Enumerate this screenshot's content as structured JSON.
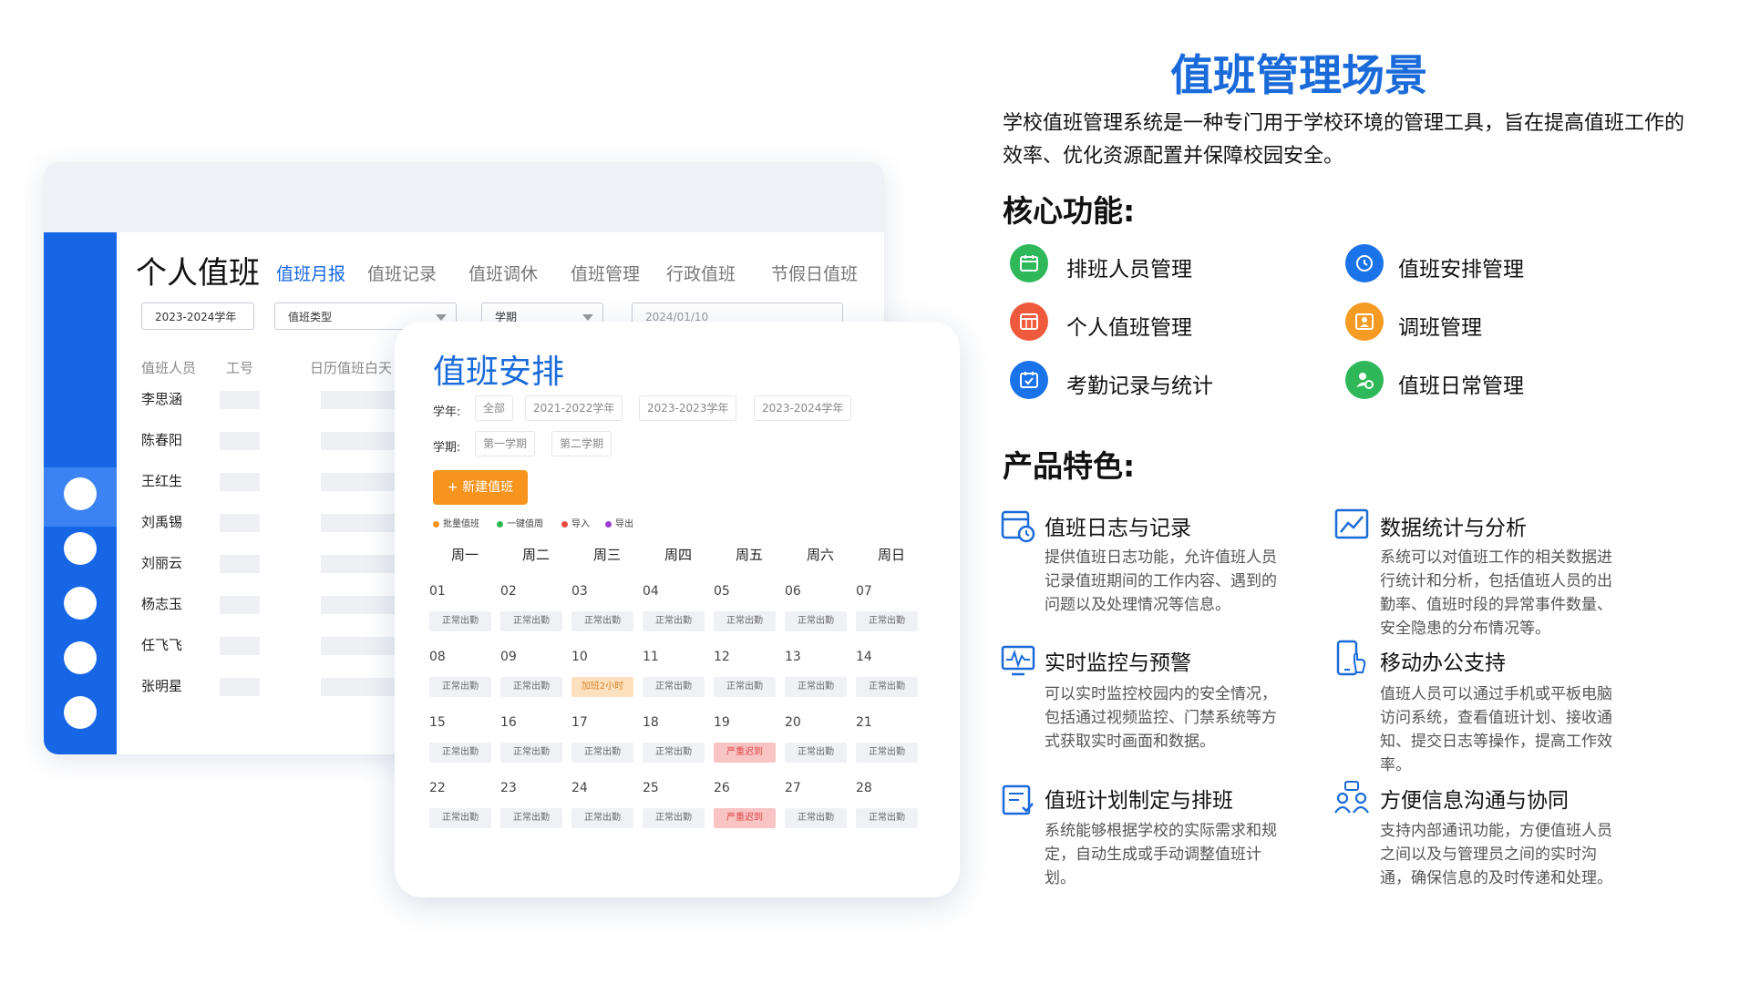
{
  "schedule_window": {
    "title": "个人值班",
    "tabs": [
      "值班月报",
      "值班记录",
      "值班调休",
      "值班管理",
      "行政值班",
      "节假日值班"
    ],
    "filters": {
      "year": "2023-2024学年",
      "duty_type": "值班类型",
      "term": "学期",
      "date": "2024/01/10"
    },
    "columns": [
      "值班人员",
      "工号",
      "日历值班白天"
    ],
    "staff": [
      "李思涵",
      "陈春阳",
      "王红生",
      "刘禹锡",
      "刘丽云",
      "杨志玉",
      "任飞飞",
      "张明星"
    ]
  },
  "arrangement_card": {
    "title": "值班安排",
    "year_label": "学年:",
    "year_options": [
      "全部",
      "2021-2022学年",
      "2023-2023学年",
      "2023-2024学年"
    ],
    "term_label": "学期:",
    "term_options": [
      "第一学期",
      "第二学期"
    ],
    "new_button": "+ 新建值班",
    "legend": [
      {
        "label": "批量值班",
        "color": "#f7941d"
      },
      {
        "label": "一键值周",
        "color": "#2db84c"
      },
      {
        "label": "导入",
        "color": "#e84b3c"
      },
      {
        "label": "导出",
        "color": "#9b3fd1"
      }
    ],
    "weekdays": [
      "周一",
      "周二",
      "周三",
      "周四",
      "周五",
      "周六",
      "周日"
    ],
    "weeks": [
      [
        [
          "01",
          "正常出勤",
          ""
        ],
        [
          "02",
          "正常出勤",
          ""
        ],
        [
          "03",
          "正常出勤",
          ""
        ],
        [
          "04",
          "正常出勤",
          ""
        ],
        [
          "05",
          "正常出勤",
          ""
        ],
        [
          "06",
          "正常出勤",
          ""
        ],
        [
          "07",
          "正常出勤",
          ""
        ]
      ],
      [
        [
          "08",
          "正常出勤",
          ""
        ],
        [
          "09",
          "正常出勤",
          ""
        ],
        [
          "10",
          "加班2小时",
          "overtime"
        ],
        [
          "11",
          "正常出勤",
          ""
        ],
        [
          "12",
          "正常出勤",
          ""
        ],
        [
          "13",
          "正常出勤",
          ""
        ],
        [
          "14",
          "正常出勤",
          ""
        ]
      ],
      [
        [
          "15",
          "正常出勤",
          ""
        ],
        [
          "16",
          "正常出勤",
          ""
        ],
        [
          "17",
          "正常出勤",
          ""
        ],
        [
          "18",
          "正常出勤",
          ""
        ],
        [
          "19",
          "严重迟到",
          "late"
        ],
        [
          "20",
          "正常出勤",
          ""
        ],
        [
          "21",
          "正常出勤",
          ""
        ]
      ],
      [
        [
          "22",
          "正常出勤",
          ""
        ],
        [
          "23",
          "正常出勤",
          ""
        ],
        [
          "24",
          "正常出勤",
          ""
        ],
        [
          "25",
          "正常出勤",
          ""
        ],
        [
          "26",
          "严重迟到",
          "late"
        ],
        [
          "27",
          "正常出勤",
          ""
        ],
        [
          "28",
          "正常出勤",
          ""
        ]
      ]
    ]
  },
  "intro": {
    "title": "值班管理场景",
    "text": "学校值班管理系统是一种专门用于学校环境的管理工具，旨在提高值班工作的效率、优化资源配置并保障校园安全。"
  },
  "core": {
    "heading": "核心功能:",
    "items": [
      {
        "label": "排班人员管理",
        "icon": "calendar-icon",
        "color": "#2fb85a"
      },
      {
        "label": "值班安排管理",
        "icon": "refresh-icon",
        "color": "#1a73e8"
      },
      {
        "label": "个人值班管理",
        "icon": "grid-calendar-icon",
        "color": "#ef5a3c"
      },
      {
        "label": "调班管理",
        "icon": "id-card-icon",
        "color": "#f59a23"
      },
      {
        "label": "考勤记录与统计",
        "icon": "check-calendar-icon",
        "color": "#1a73e8"
      },
      {
        "label": "值班日常管理",
        "icon": "user-clock-icon",
        "color": "#2fb85a"
      }
    ]
  },
  "features": {
    "heading": "产品特色:",
    "items": [
      {
        "title": "值班日志与记录",
        "icon": "calendar-clock-icon",
        "desc": "提供值班日志功能，允许值班人员记录值班期间的工作内容、遇到的问题以及处理情况等信息。"
      },
      {
        "title": "数据统计与分析",
        "icon": "chart-icon",
        "desc": "系统可以对值班工作的相关数据进行统计和分析，包括值班人员的出勤率、值班时段的异常事件数量、安全隐患的分布情况等。"
      },
      {
        "title": "实时监控与预警",
        "icon": "monitor-icon",
        "desc": "可以实时监控校园内的安全情况，包括通过视频监控、门禁系统等方式获取实时画面和数据。"
      },
      {
        "title": "移动办公支持",
        "icon": "mobile-touch-icon",
        "desc": "值班人员可以通过手机或平板电脑访问系统，查看值班计划、接收通知、提交日志等操作，提高工作效率。"
      },
      {
        "title": "值班计划制定与排班",
        "icon": "plan-icon",
        "desc": "系统能够根据学校的实际需求和规定，自动生成或手动调整值班计划。"
      },
      {
        "title": "方便信息沟通与协同",
        "icon": "team-chat-icon",
        "desc": "支持内部通讯功能，方便值班人员之间以及与管理员之间的实时沟通，确保信息的及时传递和处理。"
      }
    ]
  }
}
